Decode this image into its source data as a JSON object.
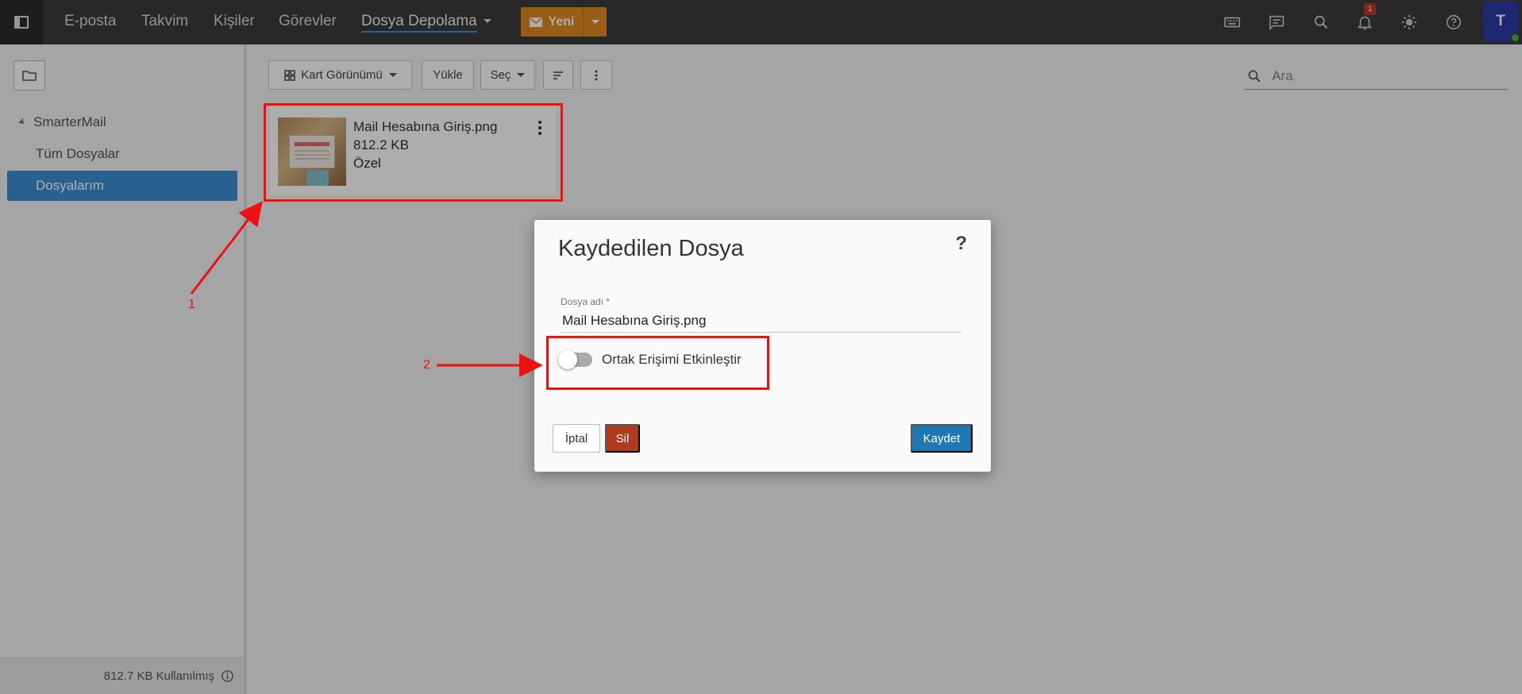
{
  "nav": {
    "items": [
      "E-posta",
      "Takvim",
      "Kişiler",
      "Görevler"
    ],
    "active": "Dosya Depolama",
    "new_button": "Yeni",
    "notification_count": "1",
    "avatar_initial": "T"
  },
  "sidebar": {
    "root": "SmarterMail",
    "items": [
      "Tüm Dosyalar",
      "Dosyalarım"
    ],
    "storage_text": "812.7 KB Kullanılmış"
  },
  "toolbar": {
    "view_label": "Kart Görünümü",
    "upload_label": "Yükle",
    "select_label": "Seç",
    "search_placeholder": "Ara"
  },
  "file": {
    "name": "Mail Hesabına Giriş.png",
    "size": "812.2 KB",
    "visibility": "Özel"
  },
  "modal": {
    "title": "Kaydedilen Dosya",
    "help": "?",
    "field_label": "Dosya adı *",
    "field_value": "Mail Hesabına Giriş.png",
    "toggle_label": "Ortak Erişimi Etkinleştir",
    "toggle_on": false,
    "cancel_label": "İptal",
    "delete_label": "Sil",
    "save_label": "Kaydet"
  },
  "annotations": {
    "label_1": "1",
    "label_2": "2",
    "color": "#ee1111"
  },
  "colors": {
    "topbar": "#3b3b3b",
    "new_button": "#e08b1f",
    "selected": "#3b8fd0",
    "save": "#1e78b4",
    "delete": "#b03a1e"
  }
}
